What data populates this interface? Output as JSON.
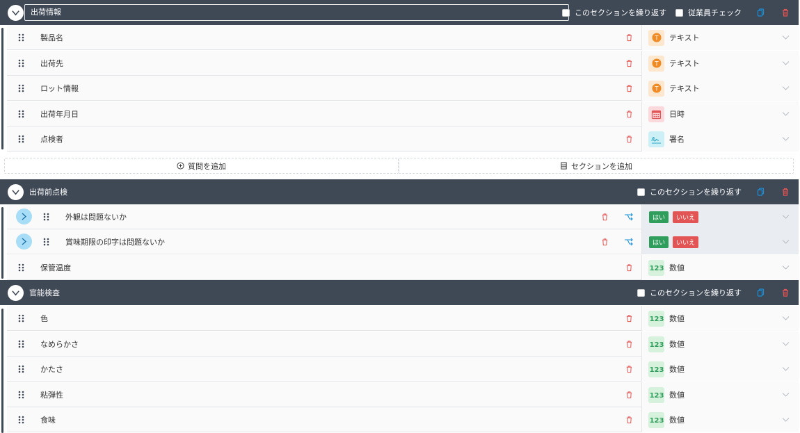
{
  "colors": {
    "header_bg": "#3f4855",
    "danger": "#e25554",
    "accent": "#1a8fd6",
    "yes": "#2f9e5c",
    "no": "#e25554"
  },
  "sections": [
    {
      "title": "出荷情報",
      "repeat_label": "このセクションを繰り返す",
      "employee_check_label": "従業員チェック",
      "questions": [
        {
          "label": "製品名",
          "type": "テキスト",
          "type_icon": "text-icon"
        },
        {
          "label": "出荷先",
          "type": "テキスト",
          "type_icon": "text-icon"
        },
        {
          "label": "ロット情報",
          "type": "テキスト",
          "type_icon": "text-icon"
        },
        {
          "label": "出荷年月日",
          "type": "日時",
          "type_icon": "calendar-icon"
        },
        {
          "label": "点検者",
          "type": "署名",
          "type_icon": "signature-icon"
        }
      ]
    },
    {
      "title": "出荷前点検",
      "repeat_label": "このセクションを繰り返す",
      "questions": [
        {
          "label": "外観は問題ないか",
          "yes": "はい",
          "no": "いいえ"
        },
        {
          "label": "賞味期限の印字は問題ないか",
          "yes": "はい",
          "no": "いいえ"
        },
        {
          "label": "保管温度",
          "type": "数値",
          "type_icon": "number-icon"
        }
      ]
    },
    {
      "title": "官能検査",
      "repeat_label": "このセクションを繰り返す",
      "questions": [
        {
          "label": "色",
          "type": "数値",
          "type_icon": "number-icon"
        },
        {
          "label": "なめらかさ",
          "type": "数値",
          "type_icon": "number-icon"
        },
        {
          "label": "かたさ",
          "type": "数値",
          "type_icon": "number-icon"
        },
        {
          "label": "粘弾性",
          "type": "数値",
          "type_icon": "number-icon"
        },
        {
          "label": "食味",
          "type": "数値",
          "type_icon": "number-icon"
        }
      ]
    }
  ],
  "add_question_label": "質問を追加",
  "add_section_label": "セクションを追加",
  "number_icon_text": "123",
  "text_icon_text": "T"
}
